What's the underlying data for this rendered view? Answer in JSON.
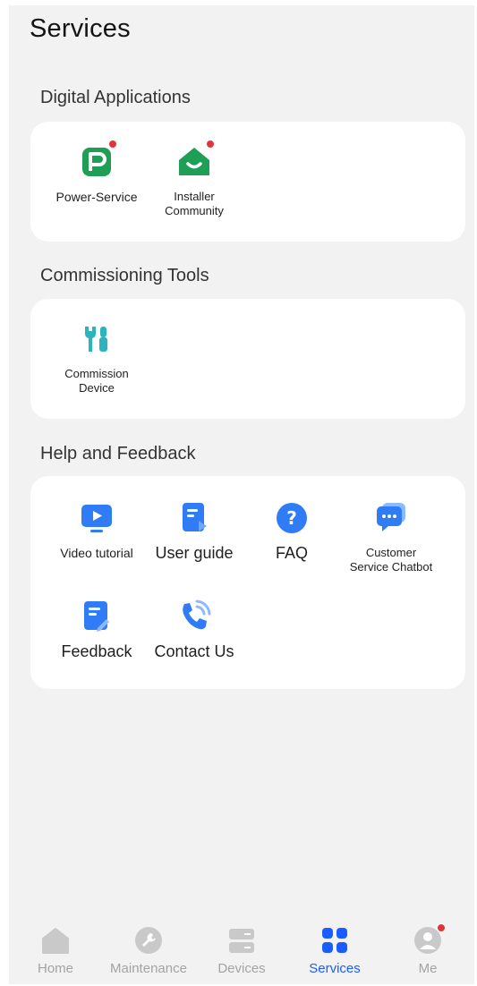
{
  "page_title": "Services",
  "sections": {
    "digital": {
      "title": "Digital Applications",
      "items": [
        {
          "label": "Power-Service"
        },
        {
          "label": "Installer\nCommunity"
        }
      ]
    },
    "commissioning": {
      "title": "Commissioning Tools",
      "items": [
        {
          "label": "Commission\nDevice"
        }
      ]
    },
    "help": {
      "title": "Help and Feedback",
      "items": [
        {
          "label": "Video tutorial"
        },
        {
          "label": "User guide"
        },
        {
          "label": "FAQ"
        },
        {
          "label": "Customer\nService Chatbot"
        },
        {
          "label": "Feedback"
        },
        {
          "label": "Contact Us"
        }
      ]
    }
  },
  "tabbar": {
    "tabs": [
      {
        "label": "Home",
        "icon": "home-icon"
      },
      {
        "label": "Maintenance",
        "icon": "wrench-icon"
      },
      {
        "label": "Devices",
        "icon": "devices-icon"
      },
      {
        "label": "Services",
        "icon": "grid-icon",
        "active": true
      },
      {
        "label": "Me",
        "icon": "user-icon"
      }
    ],
    "active_color": "#1a5cff",
    "inactive_color": "#a3a3a3"
  },
  "colors": {
    "green": "#1f9e55",
    "teal": "#2ab5be",
    "blue": "#2f7cf6",
    "badge": "#e5333a"
  }
}
